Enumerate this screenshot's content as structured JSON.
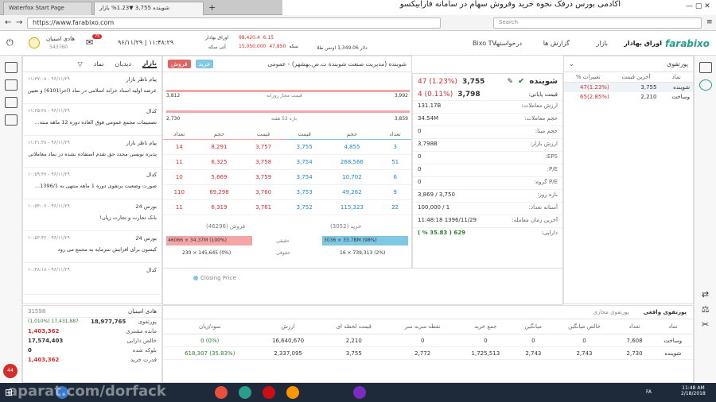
{
  "browser": {
    "tab1": "Waterfox Start Page",
    "tab2": "شوینده 3,755 ▼1.23% بازار",
    "url": "https://www.farabixo.com",
    "search_placeholder": "Search",
    "overlay": "آکادمی بورس درفک     نحوه خرید وفروش سهام در سامانه فارابیکسو"
  },
  "header": {
    "logo": "farabixo",
    "nav": [
      "اوراق بهادار",
      "بازار",
      "گزارش ها",
      "درخواستها",
      "Bixo TV"
    ],
    "date": "۹۶/۱۱/۲۹ | ۱۱:۴۸:۲۹",
    "user": "هادی امینیان",
    "user_id": "543760",
    "badge": "75",
    "oil": "اونس طلا",
    "oil_val": "1,349.06",
    "dollar": "دلار",
    "dollar_val": "",
    "sekke": "سکه",
    "sekke_val": "15,050,000",
    "sekke_val2": "47,850",
    "idx_val": "98,420.4",
    "idx_chg": "6.15",
    "bahadar": "اوراق بهادار",
    "ati": "آتی سکه"
  },
  "watch": {
    "title": "پورتفوی",
    "cols": [
      "نماد",
      "آخرین قیمت",
      "تغییرات %"
    ],
    "rows": [
      {
        "sym": "شوینده",
        "price": "3,755",
        "chg": "(1.23%)47"
      },
      {
        "sym": "وساخت",
        "price": "2,210",
        "chg": "(2.85%)65"
      }
    ]
  },
  "info": {
    "sym": "شوینده",
    "price": "3,755",
    "chg": "(1.23%) 47",
    "final_label": "قیمت پایانی:",
    "final": "3,798",
    "final_chg": "(0.11%) 4",
    "rows": [
      {
        "k": "ارزش معاملات:",
        "v": "131.17B"
      },
      {
        "k": "حجم معاملات:",
        "v": "34.54M"
      },
      {
        "k": "حجم مبنا:",
        "v": "0"
      },
      {
        "k": "ارزش بازار:",
        "v": "3,798B"
      },
      {
        "k": "EPS:",
        "v": "0"
      },
      {
        "k": "P/E:",
        "v": "0"
      },
      {
        "k": "P/E گروه:",
        "v": "0"
      },
      {
        "k": "بازه روز:",
        "v": "3,750 / 3,869"
      },
      {
        "k": "آستانه تعداد:",
        "v": "1 / 100,000"
      },
      {
        "k": "آخرین زمان معامله:",
        "v": "1396/11/29 11:48:18"
      },
      {
        "k": "دارایی:",
        "v": "629 ( 35.83 % )"
      }
    ]
  },
  "depth": {
    "title": "شوینده (مدیریت صنعت شوینده ت.ص.بهشهر) - عمومی",
    "range_low": "3,812",
    "range_high": "3,992",
    "range_label": "قیمت مجاز روزانه",
    "week_low": "2,730",
    "week_high": "3,859",
    "week_label": "بازه 52 هفته",
    "cols": [
      "تعداد",
      "حجم",
      "قیمت",
      "قیمت",
      "حجم",
      "تعداد"
    ],
    "rows": [
      [
        "3",
        "4,855",
        "3,755",
        "3,757",
        "8,291",
        "14"
      ],
      [
        "51",
        "268,566",
        "3,754",
        "3,758",
        "6,325",
        "11"
      ],
      [
        "6",
        "10,702",
        "3,754",
        "3,759",
        "5,669",
        "10"
      ],
      [
        "9",
        "49,262",
        "3,753",
        "3,760",
        "69,298",
        "110"
      ],
      [
        "22",
        "115,323",
        "3,752",
        "3,761",
        "6,319",
        "11"
      ]
    ],
    "buy_label": "خرید (3052)",
    "sell_label": "فروش (46296)",
    "haqiqi": "حقیقی",
    "hoquqi": "حقوقی",
    "buy_haq": "3036 × 33.7BM (98%)",
    "sell_haq": "46066 × 34.37M (100%)",
    "buy_hoq": "16 × 739,313 (2%)",
    "sell_hoq": "230 × 145,645 (0%)",
    "closing": "Closing Price"
  },
  "news": {
    "tabs": [
      "بازار",
      "دیدبان",
      "نماد"
    ],
    "items": [
      {
        "src": "پیام ناظر بازار",
        "date": "۹۶/۱۱/۲۹ - ۱۱:۳۷:۰۸",
        "text": "عرضه اولیه اسناد خزانه اسلامی در نماد (اخزا6101) و تعیین"
      },
      {
        "src": "کدال",
        "date": "۹۶/۱۱/۲۹ - ۱۱:۳۵:۳۸",
        "text": "تصمیمات مجمع عمومی فوق العاده دوره 12 ماهه منته..."
      },
      {
        "src": "پیام ناظر بازار",
        "date": "۹۶/۱۱/۲۹ - ۱۱:۳۱:۳۸",
        "text": "پذیره نویسی محدد حق تقدم استفاده نشده در نماد معاملاتی"
      },
      {
        "src": "کدال",
        "date": "۹۶/۱۱/۲۹ - ۱۰:۵۹:۴۷",
        "text": "صورت وضعیت پرتفوی دوره 1 ماهه منتهی به 1396/1..."
      },
      {
        "src": "بورس 24",
        "date": "۹۶/۱۱/۲۹ - ۱۰:۵۴:۰۶",
        "text": "بانک تجارت و تجارت زیان!"
      },
      {
        "src": "بورس 24",
        "date": "۹۶/۱۱/۲۹ - ۱۰:۵۳:۴۲",
        "text": "کیسون برای افزایش سرمایه به مجمع می رود"
      },
      {
        "src": "کدال",
        "date": "۹۶/۱۱/۲۹ - ۱۰:۴۸:۱۸",
        "text": ""
      }
    ]
  },
  "account": {
    "name": "هادی امینیان",
    "code": "31598",
    "rows": [
      {
        "k": "پورتفوی",
        "v": "18,977,765",
        "v2": "17,431,887 (1,010%)"
      },
      {
        "k": "مانده مشتری",
        "v": "1,403,362"
      },
      {
        "k": "خالص دارایی",
        "v": "17,574,403"
      },
      {
        "k": "بلوکه شده",
        "v": "0"
      },
      {
        "k": "قدرت خرید",
        "v": "1,403,362"
      }
    ]
  },
  "portfolio": {
    "tabs": [
      "پورتفوی واقعی",
      "پورتفوی مجازی"
    ],
    "cols": [
      "نماد",
      "تعداد",
      "خالص میانگین",
      "میانگین",
      "جمع خرید",
      "نقطه سربه سر",
      "قیمت لحظه ای",
      "ارزش",
      "سود/زیان"
    ],
    "rows": [
      [
        "وساخت",
        "7,608",
        "0",
        "0",
        "0",
        "0",
        "2,210",
        "16,640,670",
        "(0%) 0"
      ],
      [
        "شوینده",
        "2,730",
        "2,743",
        "2,743",
        "1,725,513",
        "2,772",
        "3,755",
        "2,337,095",
        "(35.83%) 618,307"
      ]
    ]
  },
  "taskbar": {
    "time": "11:48 AM",
    "date": "2/18/2018",
    "lang": "FA",
    "watermark": "aparat.com/dorfack"
  },
  "colors": {
    "brand": "#2a9d8f",
    "red": "#d32f2f",
    "green": "#2e7d32",
    "buy": "#7ec8e3",
    "sell": "#f4a6a6"
  }
}
